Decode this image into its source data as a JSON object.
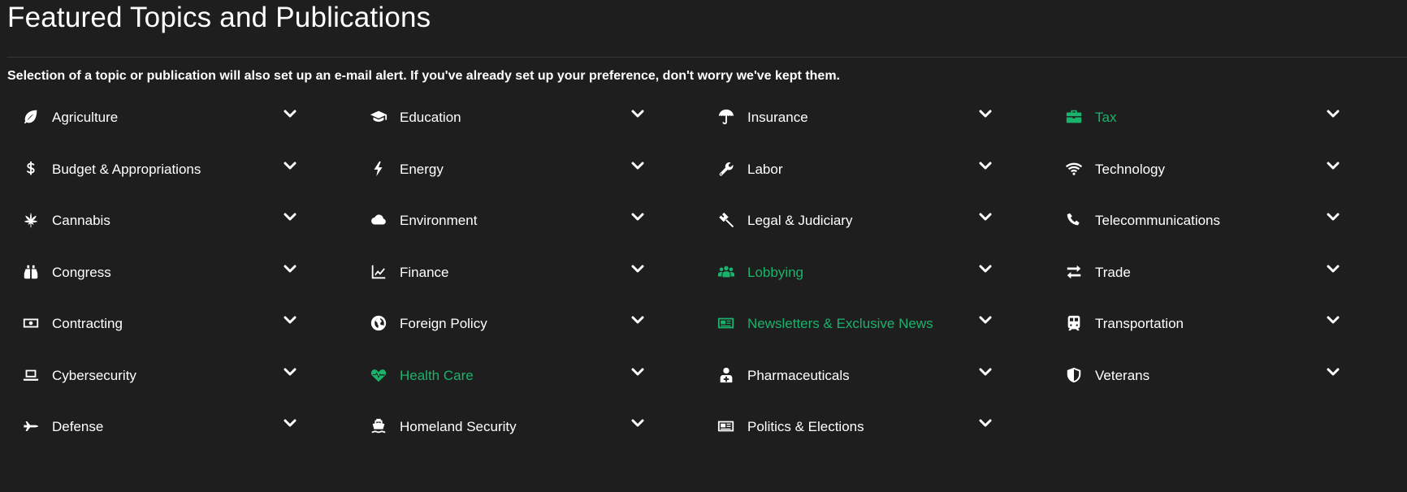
{
  "header": {
    "title": "Featured Topics and Publications",
    "subtitle": "Selection of a topic or publication will also set up an e-mail alert. If you've already set up your preference, don't worry we've kept them."
  },
  "accent_color": "#19b36b",
  "topics": [
    {
      "label": "Agriculture",
      "icon": "leaf-icon",
      "selected": false
    },
    {
      "label": "Budget & Appropriations",
      "icon": "dollar-icon",
      "selected": false
    },
    {
      "label": "Cannabis",
      "icon": "cannabis-leaf-icon",
      "selected": false
    },
    {
      "label": "Congress",
      "icon": "binoculars-icon",
      "selected": false
    },
    {
      "label": "Contracting",
      "icon": "money-bill-icon",
      "selected": false
    },
    {
      "label": "Cybersecurity",
      "icon": "laptop-icon",
      "selected": false
    },
    {
      "label": "Defense",
      "icon": "fighter-jet-icon",
      "selected": false
    },
    {
      "label": "Education",
      "icon": "graduation-cap-icon",
      "selected": false
    },
    {
      "label": "Energy",
      "icon": "bolt-icon",
      "selected": false
    },
    {
      "label": "Environment",
      "icon": "cloud-icon",
      "selected": false
    },
    {
      "label": "Finance",
      "icon": "line-chart-icon",
      "selected": false
    },
    {
      "label": "Foreign Policy",
      "icon": "globe-icon",
      "selected": false
    },
    {
      "label": "Health Care",
      "icon": "heartbeat-icon",
      "selected": true
    },
    {
      "label": "Homeland Security",
      "icon": "ship-icon",
      "selected": false
    },
    {
      "label": "Insurance",
      "icon": "umbrella-icon",
      "selected": false
    },
    {
      "label": "Labor",
      "icon": "wrench-icon",
      "selected": false
    },
    {
      "label": "Legal & Judiciary",
      "icon": "gavel-icon",
      "selected": false
    },
    {
      "label": "Lobbying",
      "icon": "users-icon",
      "selected": true
    },
    {
      "label": "Newsletters & Exclusive News",
      "icon": "newspaper-icon",
      "selected": true
    },
    {
      "label": "Pharmaceuticals",
      "icon": "doctor-icon",
      "selected": false
    },
    {
      "label": "Politics & Elections",
      "icon": "newspaper-icon",
      "selected": false
    },
    {
      "label": "Tax",
      "icon": "briefcase-icon",
      "selected": true
    },
    {
      "label": "Technology",
      "icon": "wifi-icon",
      "selected": false
    },
    {
      "label": "Telecommunications",
      "icon": "phone-icon",
      "selected": false
    },
    {
      "label": "Trade",
      "icon": "exchange-icon",
      "selected": false
    },
    {
      "label": "Transportation",
      "icon": "train-icon",
      "selected": false
    },
    {
      "label": "Veterans",
      "icon": "shield-icon",
      "selected": false
    }
  ]
}
